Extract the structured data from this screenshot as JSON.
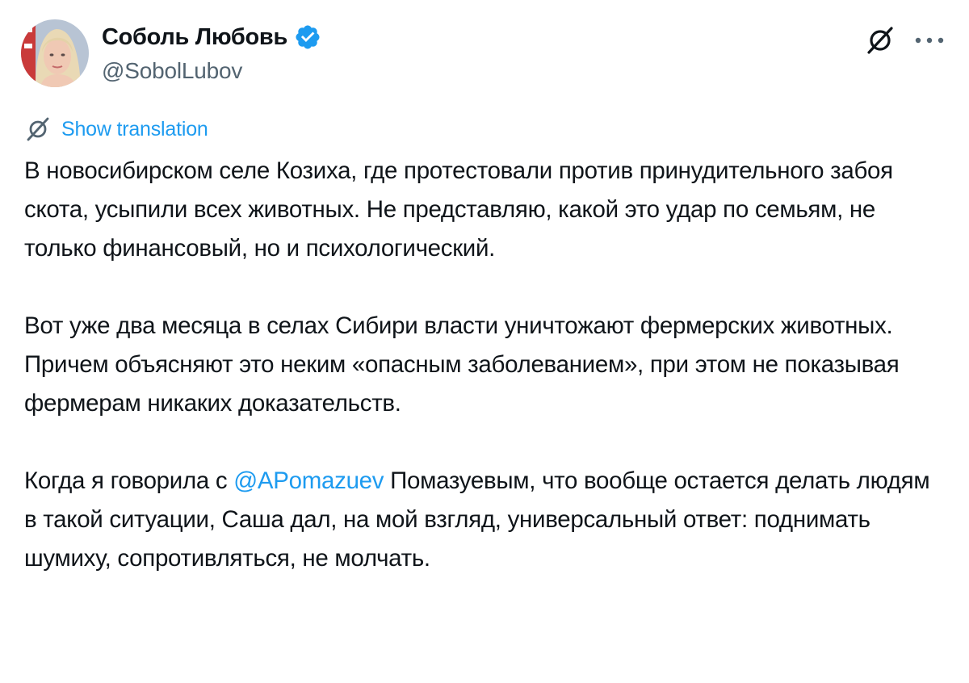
{
  "author": {
    "name": "Соболь Любовь",
    "handle": "@SobolLubov",
    "verified": true
  },
  "translate": {
    "label": "Show translation"
  },
  "icons": {
    "verified": "verified-badge-icon",
    "grok": "grok-icon",
    "more": "more-options-icon",
    "translate": "translate-icon"
  },
  "colors": {
    "accent": "#1d9bf0",
    "text": "#0f1419",
    "secondary": "#536471"
  },
  "tweet": {
    "paragraph1": "В новосибирском селе Козиха, где протестовали против принудительного забоя скота, усыпили всех животных. Не представляю, какой это удар по семьям, не только финансовый, но и психологический.",
    "paragraph2": "Вот уже два месяца в селах Сибири власти уничтожают фермерских животных. Причем объясняют это неким «опасным заболеванием», при этом не показывая фермерам никаких доказательств.",
    "paragraph3_before": "Когда я говорила с ",
    "paragraph3_mention": "@APomazuev",
    "paragraph3_after": " Помазуевым, что вообще остается делать людям в такой ситуации, Саша дал, на мой взгляд, универсальный ответ: поднимать шумиху, сопротивляться, не молчать."
  }
}
